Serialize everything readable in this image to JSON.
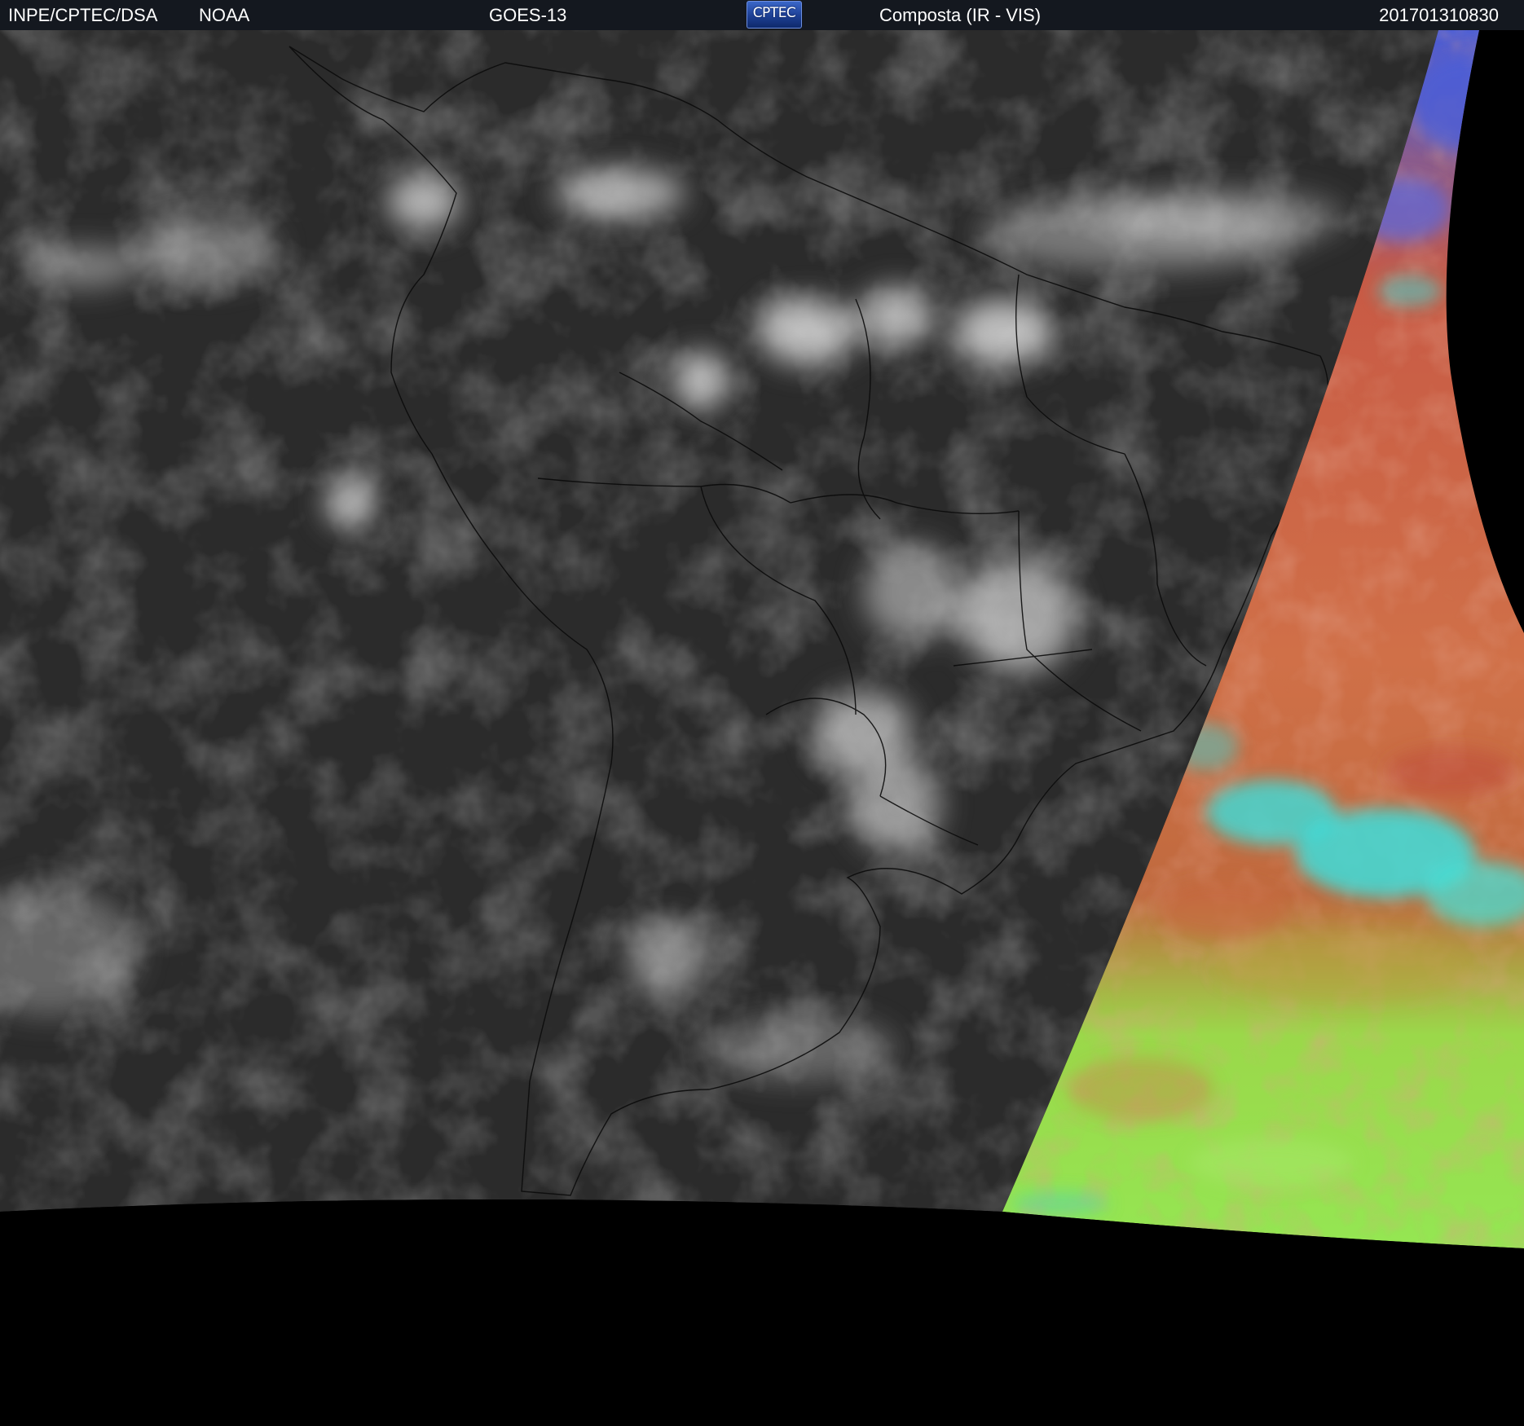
{
  "header": {
    "organization": "INPE/CPTEC/DSA",
    "agency": "NOAA",
    "satellite": "GOES-13",
    "logo_text": "CPTEC",
    "product": "Composta (IR - VIS)",
    "timestamp": "201701310830"
  },
  "image": {
    "description_icons": [
      "satellite-composite-image",
      "coastline-overlay",
      "political-borders-overlay"
    ],
    "colors": {
      "header_bg": "#14181f",
      "ir_dark": "#2b2b2b",
      "ir_cloud": "#d8d8d8",
      "vis_red": "#c0603a",
      "vis_green": "#8ff25a",
      "vis_cyan": "#33e6e6",
      "vis_blue": "#4a5ed8",
      "nodata": "#000000"
    }
  }
}
